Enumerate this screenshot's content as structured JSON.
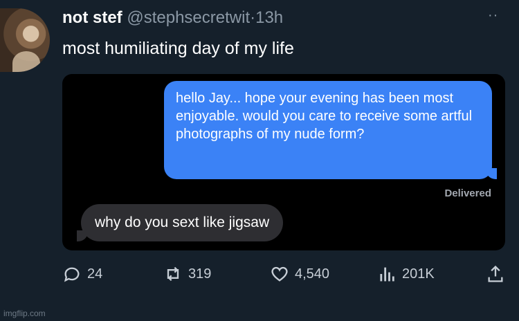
{
  "tweet": {
    "display_name": "not stef",
    "handle": "@stephsecretwit",
    "separator": "·",
    "time": "13h",
    "more_label": "··",
    "text": "most humiliating day of my life"
  },
  "messages": {
    "outgoing": "hello Jay... hope your evening has been most enjoyable. would you care to receive some artful photographs of my nude form?",
    "status": "Delivered",
    "incoming": "why do you sext like jigsaw"
  },
  "actions": {
    "replies": "24",
    "retweets": "319",
    "likes": "4,540",
    "views": "201K"
  },
  "watermark": "imgflip.com",
  "colors": {
    "background": "#15202b",
    "outgoing_bubble": "#3b82f6",
    "incoming_bubble": "#2e2e32"
  }
}
